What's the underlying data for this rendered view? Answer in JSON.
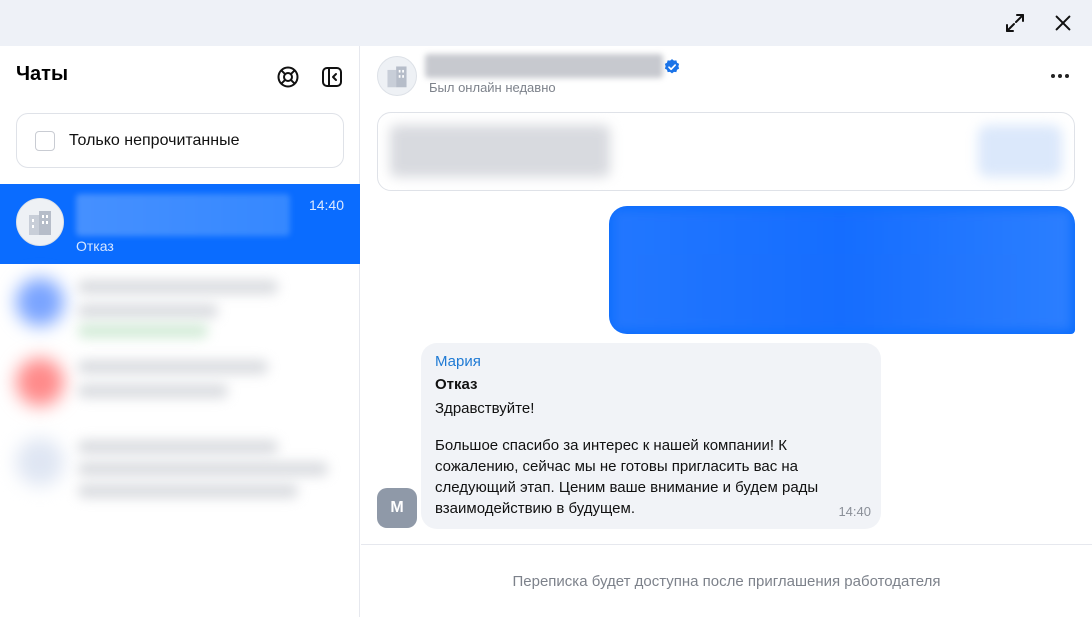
{
  "window": {
    "expand_icon": "expand-icon",
    "close_icon": "close-icon"
  },
  "sidebar": {
    "title": "Чаты",
    "support_icon": "lifebuoy-icon",
    "collapse_icon": "collapse-panel-icon",
    "filter": {
      "label": "Только непрочитанные",
      "checked": false
    },
    "active_chat": {
      "last_message": "Отказ",
      "time": "14:40"
    }
  },
  "main": {
    "status": "Был онлайн недавно",
    "message_incoming": {
      "author": "Мария",
      "avatar_letter": "М",
      "subject": "Отказ",
      "greeting": "Здравствуйте!",
      "body": "Большое спасибо за интерес к нашей компании! К сожалению, сейчас мы не готовы пригласить вас на следующий этап. Ценим ваше внимание и будем рады взаимодействию в будущем.",
      "time": "14:40"
    },
    "footer_text": "Переписка будет доступна после приглашения работодателя"
  },
  "colors": {
    "accent": "#0a6cff",
    "author_link": "#1f7ad4",
    "topbar_bg": "#eef1f7"
  }
}
